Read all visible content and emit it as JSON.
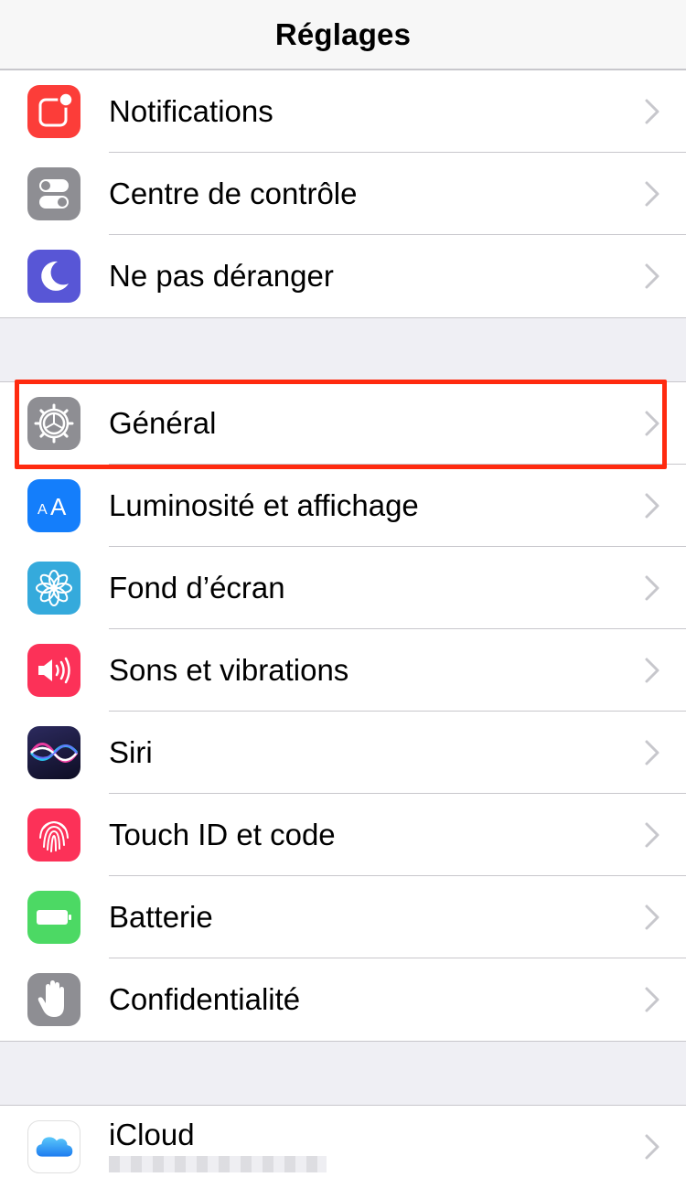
{
  "nav": {
    "title": "Réglages"
  },
  "groups": [
    {
      "items": [
        {
          "label": "Notifications",
          "icon": "notifications-icon",
          "color": "#fc3d39"
        },
        {
          "label": "Centre de contrôle",
          "icon": "control-center-icon",
          "color": "#8e8e93"
        },
        {
          "label": "Ne pas déranger",
          "icon": "moon-icon",
          "color": "#5856d6"
        }
      ]
    },
    {
      "items": [
        {
          "label": "Général",
          "icon": "gear-icon",
          "color": "#8e8e93"
        },
        {
          "label": "Luminosité et affichage",
          "icon": "text-size-icon",
          "color": "#147efb"
        },
        {
          "label": "Fond d’écran",
          "icon": "wallpaper-flower-icon",
          "color": "#35aadc"
        },
        {
          "label": "Sons et vibrations",
          "icon": "speaker-icon",
          "color": "#fc3158"
        },
        {
          "label": "Siri",
          "icon": "siri-icon",
          "color": "#1b1b3a"
        },
        {
          "label": "Touch ID et code",
          "icon": "fingerprint-icon",
          "color": "#fc3158"
        },
        {
          "label": "Batterie",
          "icon": "battery-icon",
          "color": "#4cd964"
        },
        {
          "label": "Confidentialité",
          "icon": "hand-icon",
          "color": "#8e8e93"
        }
      ]
    },
    {
      "items": [
        {
          "label": "iCloud",
          "icon": "icloud-icon",
          "color": "#ffffff"
        }
      ]
    }
  ],
  "highlight_color": "#ff2a0f"
}
